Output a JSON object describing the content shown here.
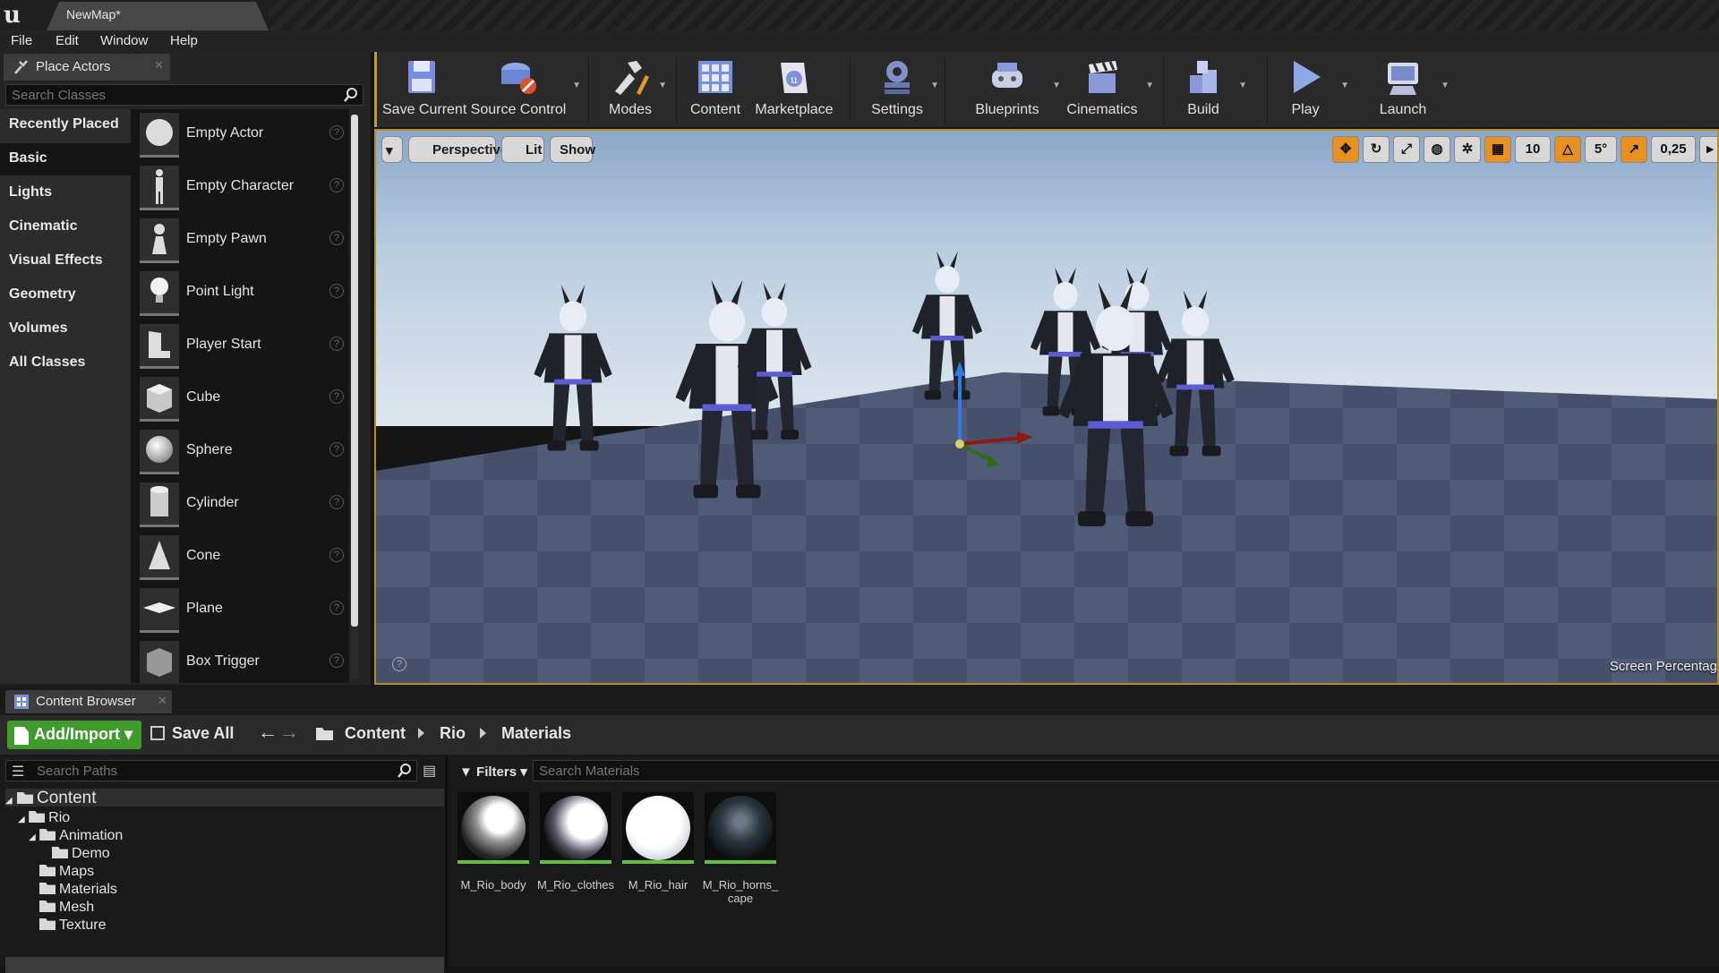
{
  "window": {
    "doc_tab": "NewMap*"
  },
  "menu": [
    "File",
    "Edit",
    "Window",
    "Help"
  ],
  "place_actors": {
    "tab_label": "Place Actors",
    "search_placeholder": "Search Classes",
    "categories": [
      "Recently Placed",
      "Basic",
      "Lights",
      "Cinematic",
      "Visual Effects",
      "Geometry",
      "Volumes",
      "All Classes"
    ],
    "active_category": "Basic",
    "actors": [
      "Empty Actor",
      "Empty Character",
      "Empty Pawn",
      "Point Light",
      "Player Start",
      "Cube",
      "Sphere",
      "Cylinder",
      "Cone",
      "Plane",
      "Box Trigger"
    ]
  },
  "toolbar": {
    "items": [
      "Save Current",
      "Source Control",
      "Modes",
      "Content",
      "Marketplace",
      "Settings",
      "Blueprints",
      "Cinematics",
      "Build",
      "Play",
      "Launch"
    ]
  },
  "viewport": {
    "perspective": "Perspective",
    "lit": "Lit",
    "show": "Show",
    "grid_snap": "10",
    "rotation_snap": "5°",
    "scale_snap": "0,25",
    "screen_percentage": "Screen Percentag",
    "help_icon": "?"
  },
  "content_browser": {
    "tab_label": "Content Browser",
    "add_import": "Add/Import",
    "save_all": "Save All",
    "breadcrumb": [
      "Content",
      "Rio",
      "Materials"
    ],
    "search_paths_placeholder": "Search Paths",
    "filters": "Filters",
    "search_materials_placeholder": "Search Materials",
    "tree": {
      "content": "Content",
      "rio": "Rio",
      "animation": "Animation",
      "demo": "Demo",
      "maps": "Maps",
      "materials": "Materials",
      "mesh": "Mesh",
      "texture": "Texture"
    },
    "assets": [
      "M_Rio_body",
      "M_Rio_clothes",
      "M_Rio_hair",
      "M_Rio_horns_\ncape"
    ]
  },
  "colors": {
    "accent_border": "#b58e1e",
    "add_green": "#3f9b2b",
    "asset_underline": "#5dc13a"
  }
}
